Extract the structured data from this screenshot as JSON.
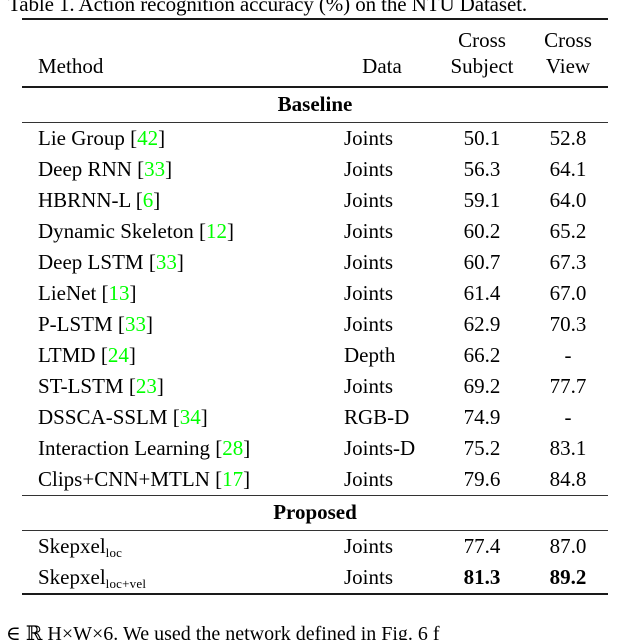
{
  "caption": {
    "top": "Table 1. Action recognition accuracy (%) on the NTU Dataset."
  },
  "table": {
    "columns": {
      "method": "Method",
      "data": "Data",
      "cross_subject_line1": "Cross",
      "cross_subject_line2": "Subject",
      "cross_view_line1": "Cross",
      "cross_view_line2": "View"
    },
    "sections": [
      {
        "title": "Baseline",
        "rows": [
          {
            "method": "Lie Group",
            "cite": "42",
            "data": "Joints",
            "cross_subject": "50.1",
            "cross_view": "52.8",
            "bold": false
          },
          {
            "method": "Deep RNN",
            "cite": "33",
            "data": "Joints",
            "cross_subject": "56.3",
            "cross_view": "64.1",
            "bold": false
          },
          {
            "method": "HBRNN-L",
            "cite": "6",
            "data": "Joints",
            "cross_subject": "59.1",
            "cross_view": "64.0",
            "bold": false
          },
          {
            "method": "Dynamic Skeleton",
            "cite": "12",
            "data": "Joints",
            "cross_subject": "60.2",
            "cross_view": "65.2",
            "bold": false
          },
          {
            "method": "Deep LSTM",
            "cite": "33",
            "data": "Joints",
            "cross_subject": "60.7",
            "cross_view": "67.3",
            "bold": false
          },
          {
            "method": "LieNet",
            "cite": "13",
            "data": "Joints",
            "cross_subject": "61.4",
            "cross_view": "67.0",
            "bold": false
          },
          {
            "method": "P-LSTM",
            "cite": "33",
            "data": "Joints",
            "cross_subject": "62.9",
            "cross_view": "70.3",
            "bold": false
          },
          {
            "method": "LTMD",
            "cite": "24",
            "data": "Depth",
            "cross_subject": "66.2",
            "cross_view": "-",
            "bold": false
          },
          {
            "method": "ST-LSTM",
            "cite": "23",
            "data": "Joints",
            "cross_subject": "69.2",
            "cross_view": "77.7",
            "bold": false
          },
          {
            "method": "DSSCA-SSLM",
            "cite": "34",
            "data": "RGB-D",
            "cross_subject": "74.9",
            "cross_view": "-",
            "bold": false
          },
          {
            "method": "Interaction Learning",
            "cite": "28",
            "data": "Joints-D",
            "cross_subject": "75.2",
            "cross_view": "83.1",
            "bold": false
          },
          {
            "method": "Clips+CNN+MTLN",
            "cite": "17",
            "data": "Joints",
            "cross_subject": "79.6",
            "cross_view": "84.8",
            "bold": false
          }
        ]
      },
      {
        "title": "Proposed",
        "rows": [
          {
            "method": "Skepxel",
            "subscript": "loc",
            "cite": "",
            "data": "Joints",
            "cross_subject": "77.4",
            "cross_view": "87.0",
            "bold": false
          },
          {
            "method": "Skepxel",
            "subscript": "loc+vel",
            "cite": "",
            "data": "Joints",
            "cross_subject": "81.3",
            "cross_view": "89.2",
            "bold": true
          }
        ]
      }
    ]
  },
  "body_text": {
    "line": "∈ ℝ H×W×6. We used the network defined in Fig. 6 f",
    "reference": "6"
  },
  "colors": {
    "citation_green": "#00ff00",
    "reference_red": "#cc0000",
    "rule_black": "#1a1a1a",
    "text_black": "#000000",
    "background": "#ffffff"
  }
}
